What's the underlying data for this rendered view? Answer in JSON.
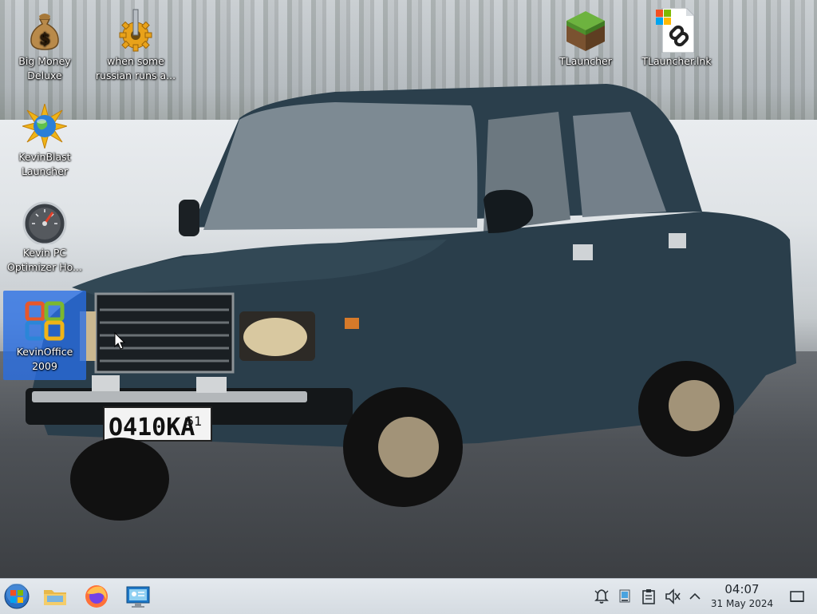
{
  "desktop": {
    "icons": [
      {
        "label": "Big Money\nDeluxe",
        "icon": "money-bag-icon"
      },
      {
        "label": "when some\nrussian runs a...",
        "icon": "gear-icon"
      },
      {
        "label": "KevinBlast\nLauncher",
        "icon": "starburst-globe-icon"
      },
      {
        "label": "Kevin PC\nOptimizer Ho...",
        "icon": "speedometer-icon"
      },
      {
        "label": "KevinOffice\n2009",
        "icon": "office-logo-icon"
      },
      {
        "label": "TLauncher",
        "icon": "grass-block-icon"
      },
      {
        "label": "TLauncher.lnk",
        "icon": "shortcut-link-icon"
      }
    ],
    "wallpaper": {
      "plate_text": "О410КА",
      "plate_region": "51"
    }
  },
  "taskbar": {
    "pinned": [
      "start-orb-icon",
      "file-manager-folder-icon",
      "firefox-icon",
      "remote-desktop-icon"
    ],
    "tray": [
      "notifications-icon",
      "network-icon",
      "clipboard-icon",
      "volume-muted-icon",
      "tray-expand-icon"
    ],
    "clock": {
      "time": "04:07",
      "date": "31 May 2024"
    },
    "show_desktop": "show-desktop-icon"
  },
  "colors": {
    "taskbar_bg": "#dde3e9",
    "selection": "#2e72e6",
    "car_body": "#2a3e4b"
  }
}
